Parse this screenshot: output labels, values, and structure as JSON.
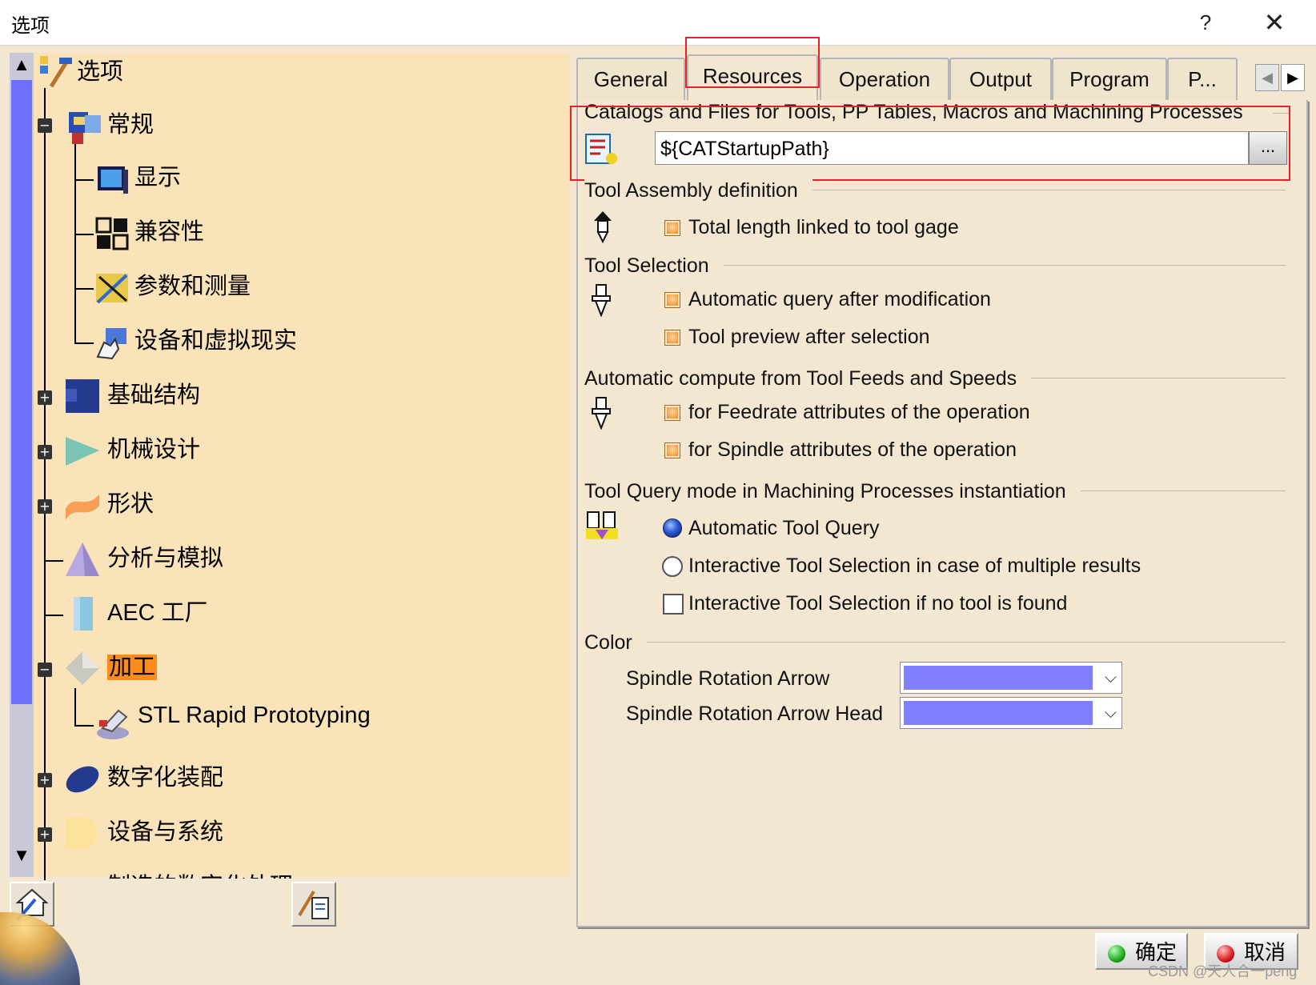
{
  "window": {
    "title": "选项",
    "help": "?",
    "close": "✕"
  },
  "tree": {
    "items": [
      {
        "label": "选项"
      },
      {
        "label": "常规"
      },
      {
        "label": "显示"
      },
      {
        "label": "兼容性"
      },
      {
        "label": "参数和测量"
      },
      {
        "label": "设备和虚拟现实"
      },
      {
        "label": "基础结构"
      },
      {
        "label": "机械设计"
      },
      {
        "label": "形状"
      },
      {
        "label": "分析与模拟"
      },
      {
        "label": "AEC 工厂"
      },
      {
        "label": "加工"
      },
      {
        "label": "STL Rapid Prototyping"
      },
      {
        "label": "数字化装配"
      },
      {
        "label": "设备与系统"
      },
      {
        "label": "制造的数字化处理"
      }
    ],
    "selected": "加工",
    "selected_color": "#ff8c1a",
    "scroll_up": "▲",
    "scroll_down": "▼"
  },
  "tabs": {
    "items": [
      {
        "label": "General"
      },
      {
        "label": "Resources"
      },
      {
        "label": "Operation"
      },
      {
        "label": "Output"
      },
      {
        "label": "Program"
      },
      {
        "label": "P..."
      }
    ],
    "active": "Resources",
    "nav_left": "◀",
    "nav_right": "▶"
  },
  "resources": {
    "catalogs_title": "Catalogs and Files for Tools, PP Tables, Macros and Machining Processes",
    "catalogs_path": "${CATStartupPath}",
    "browse_label": "...",
    "tool_assembly_title": "Tool Assembly definition",
    "tool_assembly_option": "Total length linked to tool gage",
    "tool_selection_title": "Tool Selection",
    "tool_selection_options": [
      "Automatic query after modification",
      "Tool preview after selection"
    ],
    "auto_compute_title": "Automatic compute from Tool Feeds and Speeds",
    "auto_compute_options": [
      "for Feedrate attributes of the operation",
      "for Spindle attributes of the operation"
    ],
    "query_mode_title": "Tool Query mode in Machining Processes instantiation",
    "query_mode_options": [
      "Automatic Tool Query",
      "Interactive Tool Selection in case of multiple results",
      "Interactive Tool Selection if no tool is found"
    ],
    "query_mode_selected": "Automatic Tool Query",
    "color_title": "Color",
    "color_rows": [
      {
        "label": "Spindle Rotation Arrow",
        "color": "#7f7fff"
      },
      {
        "label": "Spindle Rotation Arrow Head",
        "color": "#7f7fff"
      }
    ],
    "dropdown_arrow": "⌵"
  },
  "buttons": {
    "ok": "确定",
    "cancel": "取消"
  },
  "watermark": "CSDN @天人合一peng",
  "icons": {
    "ok_ball": "#1eaa1e",
    "cancel_ball": "#dd1a1a"
  }
}
